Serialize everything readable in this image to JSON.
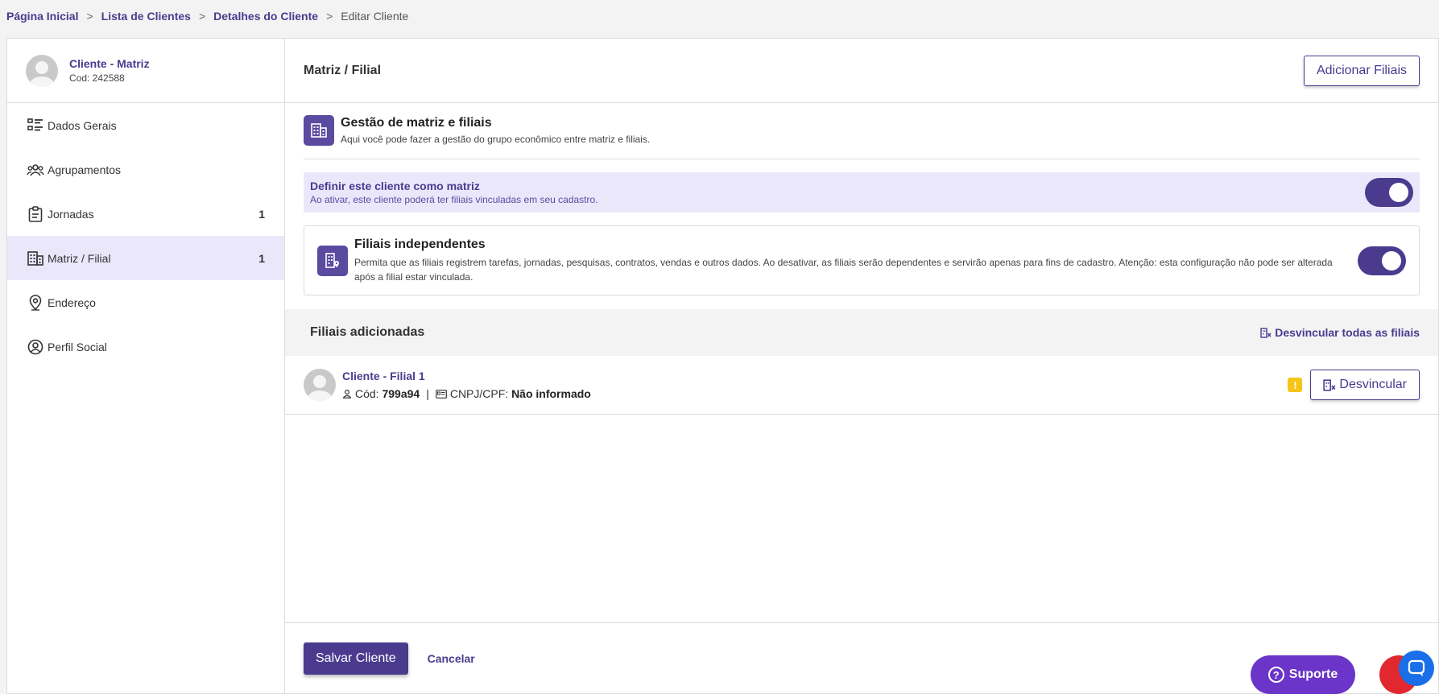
{
  "breadcrumb": {
    "items": [
      "Página Inicial",
      "Lista de Clientes",
      "Detalhes do Cliente"
    ],
    "current": "Editar Cliente",
    "separator": ">"
  },
  "profile": {
    "name": "Cliente - Matriz",
    "code": "Cod: 242588"
  },
  "sidebar": {
    "items": [
      {
        "label": "Dados Gerais",
        "icon": "list-icon",
        "badge": ""
      },
      {
        "label": "Agrupamentos",
        "icon": "group-icon",
        "badge": ""
      },
      {
        "label": "Jornadas",
        "icon": "clipboard-icon",
        "badge": "1"
      },
      {
        "label": "Matriz / Filial",
        "icon": "building-icon",
        "badge": "1",
        "active": true
      },
      {
        "label": "Endereço",
        "icon": "location-pin-icon",
        "badge": ""
      },
      {
        "label": "Perfil Social",
        "icon": "user-circle-icon",
        "badge": ""
      }
    ]
  },
  "main": {
    "title": "Matriz / Filial",
    "add_button": "Adicionar Filiais",
    "management": {
      "title": "Gestão de matriz e filiais",
      "description": "Aqui você pode fazer a gestão do grupo econômico entre matriz e filiais."
    },
    "matrix_option": {
      "title": "Definir este cliente como matriz",
      "description": "Ao ativar, este cliente poderá ter filiais vinculadas em seu cadastro.",
      "enabled": true
    },
    "independent_option": {
      "title": "Filiais independentes",
      "description": "Permita que as filiais registrem tarefas, jornadas, pesquisas, contratos, vendas e outros dados. Ao desativar, as filiais serão dependentes e servirão apenas para fins de cadastro. Atenção: esta configuração não pode ser alterada após a filial estar vinculada.",
      "enabled": true
    },
    "branches": {
      "title": "Filiais adicionadas",
      "unlink_all": "Desvincular todas as filiais",
      "items": [
        {
          "name": "Cliente - Filial 1",
          "code_label": "Cód:",
          "code": "799a94",
          "doc_label": "CNPJ/CPF:",
          "doc": "Não informado",
          "separator": "|",
          "warning": "!",
          "unlink": "Desvincular"
        }
      ]
    }
  },
  "footer": {
    "save": "Salvar Cliente",
    "cancel": "Cancelar"
  },
  "widgets": {
    "support": "Suporte"
  },
  "colors": {
    "brand": "#4a3b8f",
    "active_bg": "#ebe7fb",
    "warning": "#f5c518",
    "support": "#6a35c8",
    "chat": "#1a6fe8",
    "fab": "#e0282e"
  }
}
